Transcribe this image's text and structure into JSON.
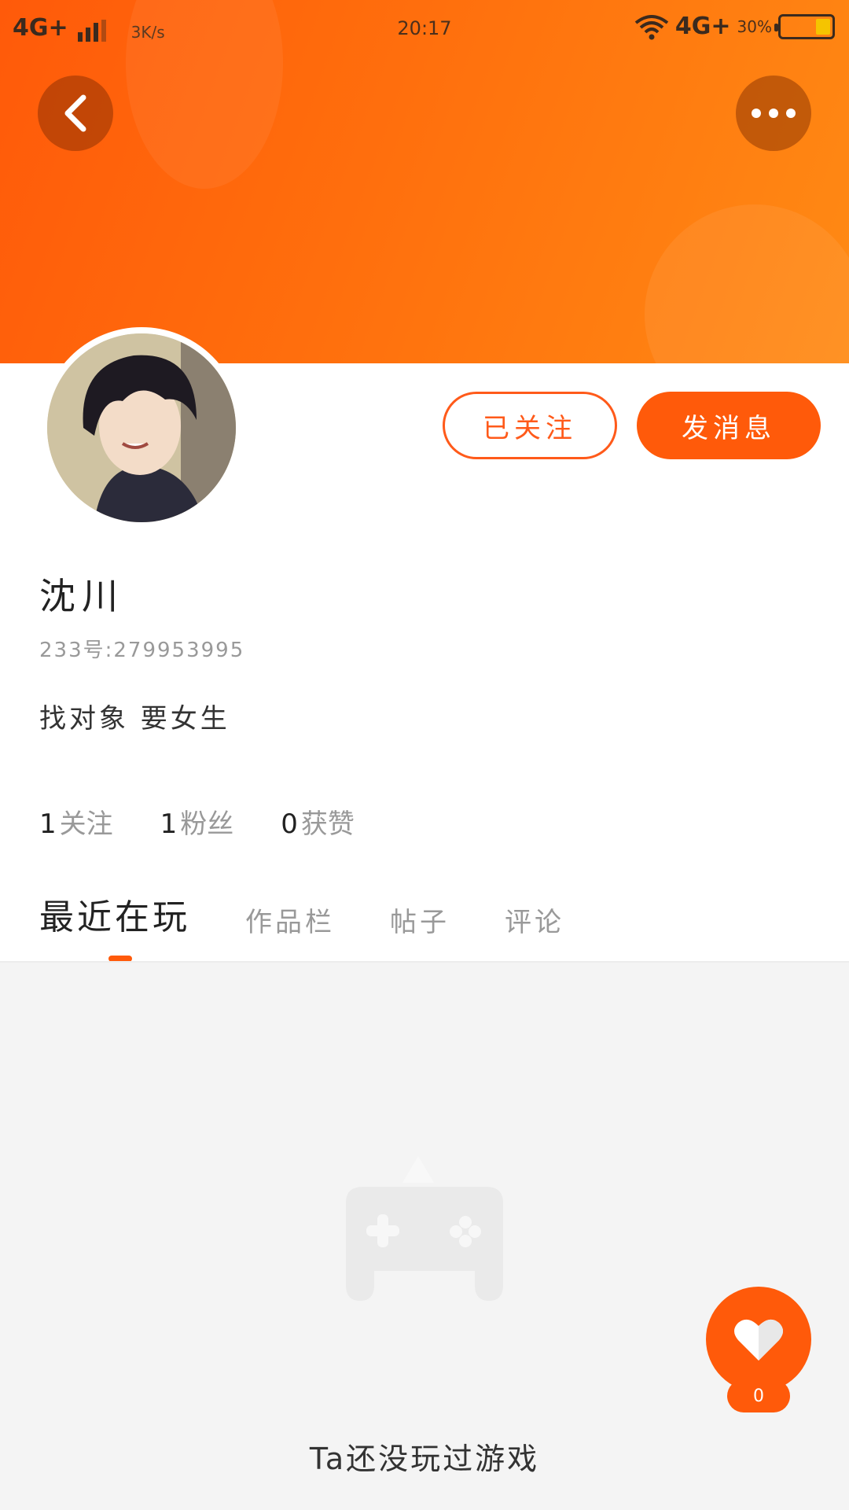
{
  "status_bar": {
    "network_left": "4G+",
    "speed": "3K/s",
    "time": "20:17",
    "network_right": "4G+",
    "battery_percent": "30%",
    "battery_level": 0.3
  },
  "header": {
    "back_icon": "chevron-left-icon",
    "more_icon": "more-dots-icon",
    "banner_color": "#ff6a0d"
  },
  "profile": {
    "username": "沈川",
    "uid": "233号:279953995",
    "bio": "找对象 要女生",
    "follow_button": "已关注",
    "message_button": "发消息"
  },
  "stats": [
    {
      "value": "1",
      "label": "关注"
    },
    {
      "value": "1",
      "label": "粉丝"
    },
    {
      "value": "0",
      "label": "获赞"
    }
  ],
  "tabs": [
    {
      "label": "最近在玩",
      "active": true
    },
    {
      "label": "作品栏",
      "active": false
    },
    {
      "label": "帖子",
      "active": false
    },
    {
      "label": "评论",
      "active": false
    }
  ],
  "content": {
    "empty_icon": "gamepad-icon",
    "empty_text": "Ta还没玩过游戏"
  },
  "like": {
    "icon": "heart-icon",
    "count": "0"
  },
  "colors": {
    "accent": "#ff5a0a",
    "background": "#f4f4f4"
  }
}
